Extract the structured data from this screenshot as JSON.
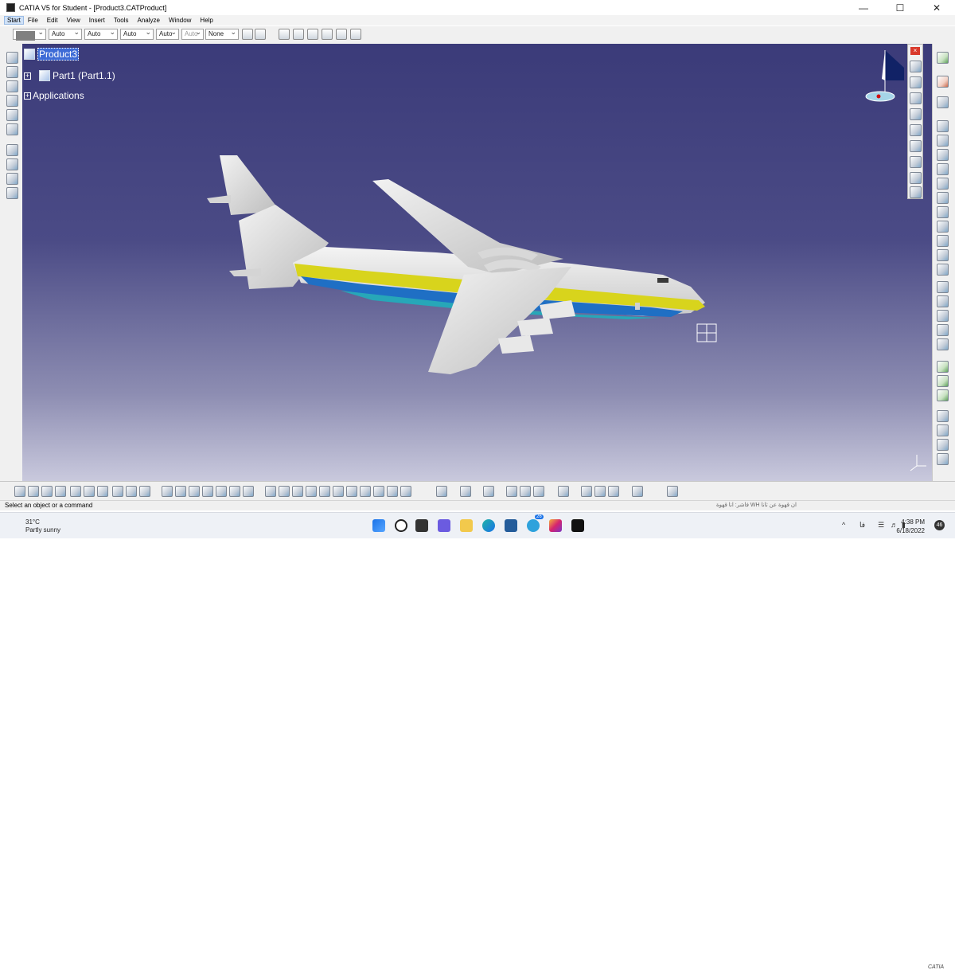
{
  "window": {
    "title": "CATIA V5 for Student - [Product3.CATProduct]",
    "minimize": "—",
    "maximize": "☐",
    "close": "✕"
  },
  "menu": [
    "Start",
    "File",
    "Edit",
    "View",
    "Insert",
    "Tools",
    "Analyze",
    "Window",
    "Help"
  ],
  "properties": {
    "combo1": "Auto",
    "combo2": "Auto",
    "combo3": "Auto",
    "combo4": "Auto",
    "combo5": "Auto",
    "combo6": "None"
  },
  "tree": {
    "root": "Product3",
    "part": "Part1 (Part1.1)",
    "applications": "Applications"
  },
  "status": {
    "message": "Select an object or a command",
    "rtl_text": "فاشر: انا قهوة WH ان قهوة عن ثانا"
  },
  "taskbar": {
    "temperature": "31°C",
    "weather": "Partly sunny",
    "time": "4:38 PM",
    "date": "6/18/2022",
    "badge": "46",
    "telegram_badge": "26",
    "lang": "فا"
  },
  "colors": {
    "viewport_top": "#3b3b79",
    "fuselage": "#e8e8e8",
    "stripe_yellow": "#d8d41c",
    "stripe_blue": "#1f6fc4",
    "stripe_teal": "#27a7b8"
  }
}
